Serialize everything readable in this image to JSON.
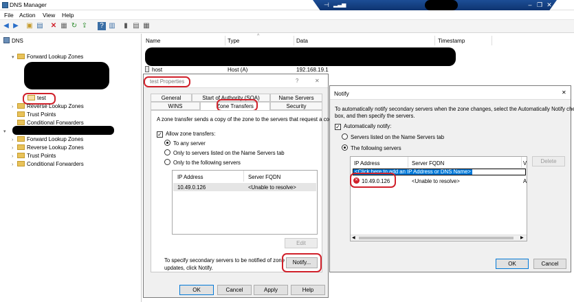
{
  "window": {
    "title": "DNS Manager"
  },
  "menu": [
    "File",
    "Action",
    "View",
    "Help"
  ],
  "tree": {
    "root": "DNS",
    "forward1": "Forward Lookup Zones",
    "test": "test",
    "reverse1": "Reverse Lookup Zones",
    "trust1": "Trust Points",
    "cond1": "Conditional Forwarders",
    "forward2": "Forward Lookup Zones",
    "reverse2": "Reverse Lookup Zones",
    "trust2": "Trust Points",
    "cond2": "Conditional Forwarders"
  },
  "list": {
    "headers": [
      "Name",
      "Type",
      "Data",
      "Timestamp"
    ],
    "rows": [
      {
        "name": "host",
        "type": "Host (A)",
        "data": "192.168.19.1"
      }
    ]
  },
  "props": {
    "title": "test Properties",
    "help_glyph": "?",
    "close_glyph": "✕",
    "tabs_top": [
      "General",
      "Start of Authority (SOA)",
      "Name Servers"
    ],
    "tabs_bottom": [
      "WINS",
      "Zone Transfers",
      "Security"
    ],
    "intro": "A zone transfer sends a copy of the zone to the servers that request a copy.",
    "allow": "Allow zone transfers:",
    "opt_any": "To any server",
    "opt_ns": "Only to servers listed on the Name Servers tab",
    "opt_following": "Only to the following servers",
    "grid_headers": [
      "IP Address",
      "Server FQDN"
    ],
    "grid_row": {
      "ip": "10.49.0.126",
      "fqdn": "<Unable to resolve>"
    },
    "edit": "Edit",
    "notify_text_1": "To specify secondary servers to be notified of zone",
    "notify_text_2": "updates, click Notify.",
    "notify_btn": "Notify...",
    "ok": "OK",
    "cancel": "Cancel",
    "apply": "Apply",
    "help": "Help"
  },
  "notify": {
    "title": "Notify",
    "close_glyph": "✕",
    "desc_1": "To automatically notify secondary servers when the zone changes, select the Automatically Notify check",
    "desc_2": "box, and then specify the servers.",
    "auto": "Automatically notify:",
    "opt_ns": "Servers listed on the Name Servers tab",
    "opt_following": "The following servers",
    "grid_headers": [
      "IP Address",
      "Server FQDN",
      "V"
    ],
    "placeholder": "<Click here to add an IP Address or DNS Name>",
    "row": {
      "ip": "10.49.0.126",
      "fqdn": "<Unable to resolve>",
      "v": "A"
    },
    "delete": "Delete",
    "ok": "OK",
    "cancel": "Cancel"
  }
}
